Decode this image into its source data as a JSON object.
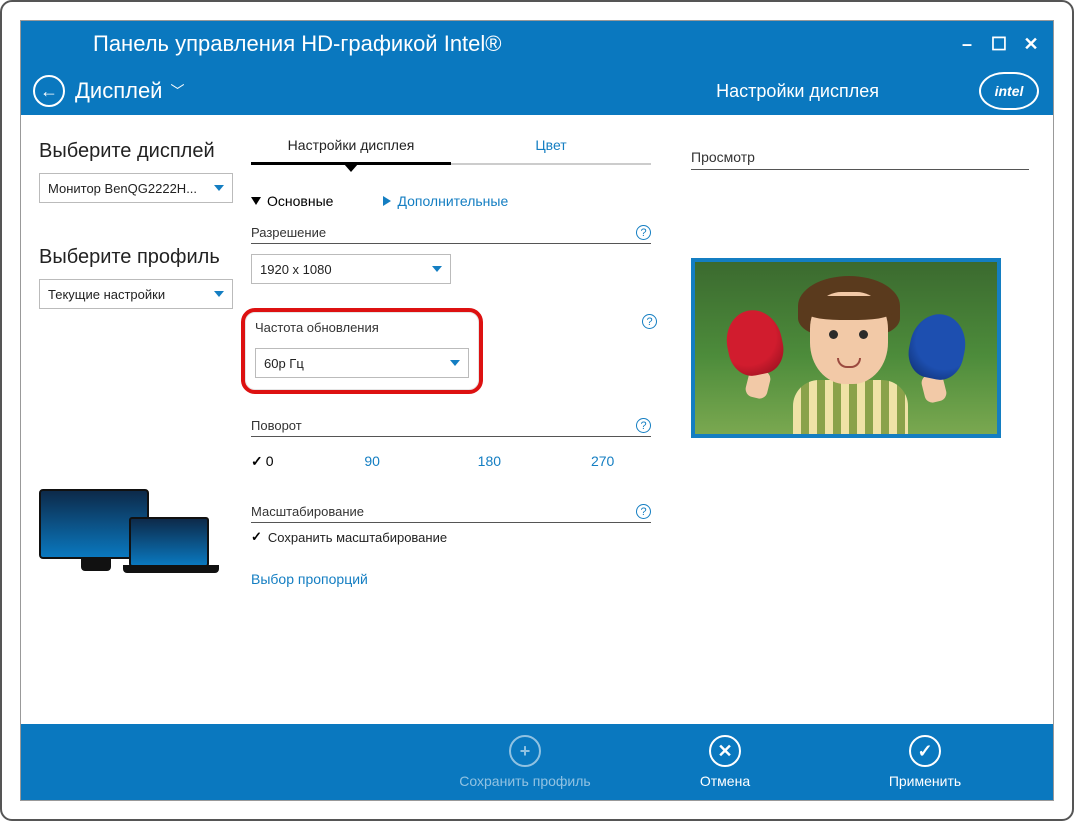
{
  "window": {
    "title": "Панель управления HD-графикой Intel®",
    "logo_text": "intel"
  },
  "nav": {
    "section": "Дисплей",
    "page": "Настройки дисплея"
  },
  "sidebar": {
    "select_display_heading": "Выберите дисплей",
    "display_value": "Монитор BenQG2222H...",
    "select_profile_heading": "Выберите профиль",
    "profile_value": "Текущие настройки"
  },
  "tabs": {
    "settings": "Настройки дисплея",
    "color": "Цвет"
  },
  "subtabs": {
    "basic": "Основные",
    "advanced": "Дополнительные"
  },
  "settings": {
    "resolution_label": "Разрешение",
    "resolution_value": "1920 x 1080",
    "refresh_label": "Частота обновления",
    "refresh_value": "60p Гц",
    "rotation_label": "Поворот",
    "rotation_options": {
      "r0": "0",
      "r90": "90",
      "r180": "180",
      "r270": "270"
    },
    "scaling_label": "Масштабирование",
    "scaling_value": "Сохранить масштабирование",
    "aspect_link": "Выбор пропорций"
  },
  "preview": {
    "label": "Просмотр"
  },
  "footer": {
    "save_profile": "Сохранить профиль",
    "cancel": "Отмена",
    "apply": "Применить"
  }
}
